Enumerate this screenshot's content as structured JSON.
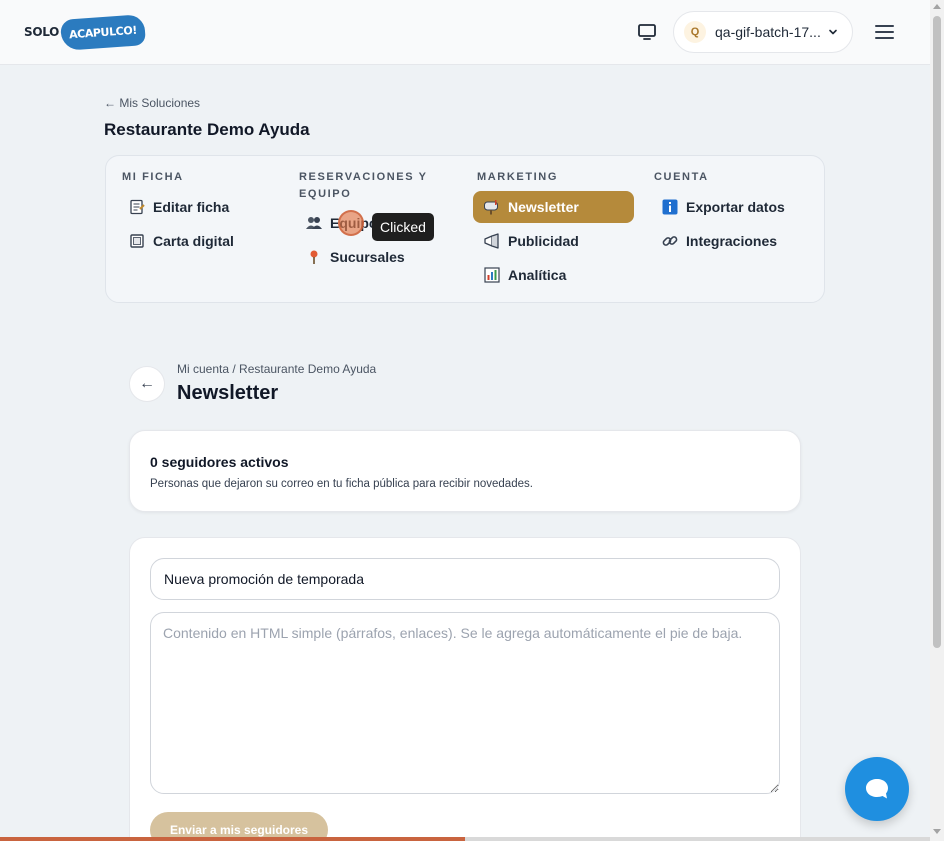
{
  "header": {
    "logo_solo": "SOLO",
    "logo_brand": "ACAPULCO!",
    "user_initial": "Q",
    "user_name": "qa-gif-batch-17...",
    "icons": [
      "monitor-icon",
      "chevron-down-icon",
      "hamburger-menu-icon"
    ]
  },
  "breadcrumb": {
    "back_label": "← Mis Soluciones"
  },
  "business_title": "Restaurante Demo Ayuda",
  "nav": {
    "columns": [
      {
        "heading": "MI FICHA",
        "items": [
          {
            "label": "Editar ficha",
            "icon": "memo-icon"
          },
          {
            "label": "Carta digital",
            "icon": "frame-icon"
          }
        ]
      },
      {
        "heading": "RESERVACIONES Y EQUIPO",
        "items": [
          {
            "label": "Equipo",
            "icon": "people-icon"
          },
          {
            "label": "Sucursales",
            "icon": "pin-icon"
          }
        ]
      },
      {
        "heading": "MARKETING",
        "items": [
          {
            "label": "Newsletter",
            "icon": "mailbox-icon",
            "active": true
          },
          {
            "label": "Publicidad",
            "icon": "megaphone-icon"
          },
          {
            "label": "Analítica",
            "icon": "bar-chart-icon"
          }
        ]
      },
      {
        "heading": "CUENTA",
        "items": [
          {
            "label": "Exportar datos",
            "icon": "info-icon"
          },
          {
            "label": "Integraciones",
            "icon": "link-icon"
          }
        ]
      }
    ],
    "active_color": "#b58a3b"
  },
  "tooltip": "Clicked",
  "section": {
    "breadcrumb": "Mi cuenta / Restaurante Demo Ayuda",
    "title": "Newsletter",
    "back_arrow": "←"
  },
  "followers": {
    "count_label": "0 seguidores activos",
    "description": "Personas que dejaron su correo en tu ficha pública para recibir novedades."
  },
  "compose": {
    "subject_value": "Nueva promoción de temporada",
    "body_placeholder": "Contenido en HTML simple (párrafos, enlaces). Se le agrega automáticamente el pie de baja.",
    "send_label": "Enviar a mis seguidores"
  },
  "progress": {
    "fraction": 0.5
  },
  "colors": {
    "brand_blue": "#2b7bbf",
    "accent_gold": "#b58a3b",
    "chat_blue": "#1f8fe0"
  }
}
